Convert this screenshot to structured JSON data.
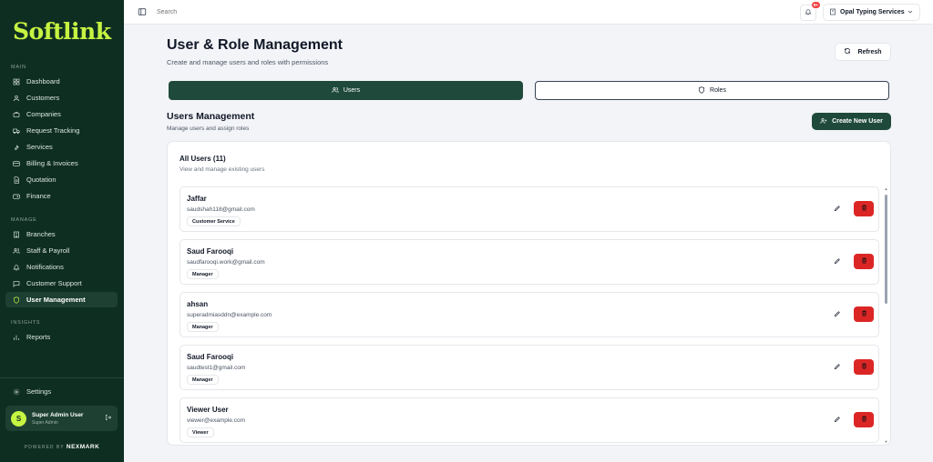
{
  "brand": {
    "logo": "Softlink",
    "powered_prefix": "POWERED BY",
    "powered_name": "NEXMARK"
  },
  "sidebar": {
    "sections": {
      "main": "MAIN",
      "manage": "MANAGE",
      "insights": "INSIGHTS"
    },
    "items": [
      {
        "label": "Dashboard",
        "icon": "dashboard-icon"
      },
      {
        "label": "Customers",
        "icon": "user-icon"
      },
      {
        "label": "Companies",
        "icon": "briefcase-icon"
      },
      {
        "label": "Request Tracking",
        "icon": "truck-icon"
      },
      {
        "label": "Services",
        "icon": "wrench-icon"
      },
      {
        "label": "Billing & Invoices",
        "icon": "card-icon"
      },
      {
        "label": "Quotation",
        "icon": "document-icon"
      },
      {
        "label": "Finance",
        "icon": "wallet-icon"
      },
      {
        "label": "Branches",
        "icon": "building-icon"
      },
      {
        "label": "Staff & Payroll",
        "icon": "users-icon"
      },
      {
        "label": "Notifications",
        "icon": "bell-icon"
      },
      {
        "label": "Customer Support",
        "icon": "chat-icon"
      },
      {
        "label": "User Management",
        "icon": "shield-icon"
      },
      {
        "label": "Reports",
        "icon": "bar-chart-icon"
      }
    ],
    "active": "User Management",
    "settings_label": "Settings",
    "user": {
      "initial": "S",
      "name": "Super Admin User",
      "role": "Super Admin"
    }
  },
  "topbar": {
    "search_placeholder": "Search",
    "notification_badge": "9+",
    "company": "Opal Typing Services"
  },
  "page": {
    "title": "User & Role Management",
    "subtitle": "Create and manage users and roles with permissions",
    "refresh_label": "Refresh",
    "tabs": {
      "users": "Users",
      "roles": "Roles"
    },
    "section_title": "Users Management",
    "section_sub": "Manage users and assign roles",
    "create_label": "Create New User",
    "card_title": "All Users (11)",
    "card_sub": "View and manage existing users"
  },
  "users": [
    {
      "name": "Jaffar",
      "email": "saudshah118@gmail.com",
      "role": "Customer Service"
    },
    {
      "name": "Saud Farooqi",
      "email": "saudfarooqi.work@gmail.com",
      "role": "Manager"
    },
    {
      "name": "ahsan",
      "email": "superadmiasddn@example.com",
      "role": "Manager"
    },
    {
      "name": "Saud Farooqi",
      "email": "saudtest1@gmail.com",
      "role": "Manager"
    },
    {
      "name": "Viewer User",
      "email": "viewer@example.com",
      "role": "Viewer"
    }
  ],
  "colors": {
    "sidebar_bg": "#0f2e22",
    "accent_lime": "#c6f442",
    "primary_green": "#1f4a3b",
    "danger": "#dc2626"
  }
}
